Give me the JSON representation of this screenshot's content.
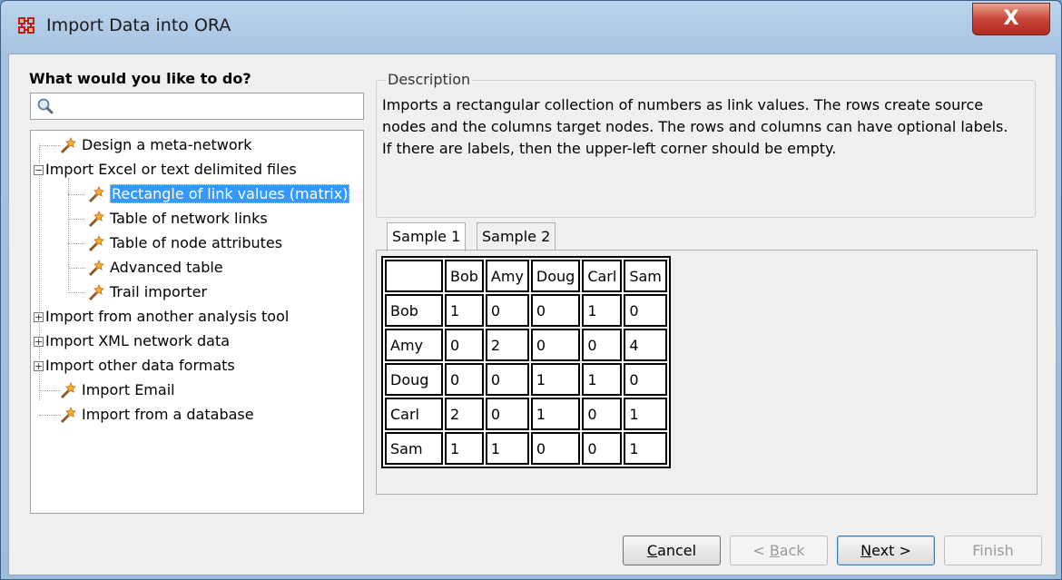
{
  "window": {
    "title": "Import Data into ORA",
    "close_glyph": "X",
    "app_icon": "ora-grid-icon"
  },
  "left": {
    "heading": "What would you like to do?",
    "search": {
      "placeholder": "",
      "icon": "search-icon"
    },
    "tree": [
      {
        "label": "Design a meta-network",
        "level": 0,
        "wand": true
      },
      {
        "label": "Import Excel or text delimited files",
        "level": 0,
        "expander": "−"
      },
      {
        "label": "Rectangle of link values (matrix)",
        "level": 1,
        "wand": true,
        "selected": true
      },
      {
        "label": "Table of network links",
        "level": 1,
        "wand": true
      },
      {
        "label": "Table of node attributes",
        "level": 1,
        "wand": true
      },
      {
        "label": "Advanced table",
        "level": 1,
        "wand": true
      },
      {
        "label": "Trail importer",
        "level": 1,
        "wand": true
      },
      {
        "label": "Import from another analysis tool",
        "level": 0,
        "expander": "+"
      },
      {
        "label": "Import XML network data",
        "level": 0,
        "expander": "+"
      },
      {
        "label": "Import other data formats",
        "level": 0,
        "expander": "+"
      },
      {
        "label": "Import Email",
        "level": 0,
        "wand": true
      },
      {
        "label": "Import from a database",
        "level": 0,
        "wand": true
      }
    ]
  },
  "description": {
    "label": "Description",
    "text": "Imports a rectangular collection of numbers as link values. The rows create source nodes and the columns target nodes. The rows and columns can have optional labels. If there are labels, then the upper-left corner should be empty."
  },
  "tabs": [
    {
      "label": "Sample 1",
      "active": true
    },
    {
      "label": "Sample 2",
      "active": false
    }
  ],
  "sample_table": {
    "header": [
      "",
      "Bob",
      "Amy",
      "Doug",
      "Carl",
      "Sam"
    ],
    "rows": [
      [
        "Bob",
        "1",
        "0",
        "0",
        "1",
        "0"
      ],
      [
        "Amy",
        "0",
        "2",
        "0",
        "0",
        "4"
      ],
      [
        "Doug",
        "0",
        "0",
        "1",
        "1",
        "0"
      ],
      [
        "Carl",
        "2",
        "0",
        "1",
        "0",
        "1"
      ],
      [
        "Sam",
        "1",
        "1",
        "0",
        "0",
        "1"
      ]
    ]
  },
  "buttons": {
    "cancel": {
      "pre": "",
      "u": "C",
      "post": "ancel",
      "enabled": true
    },
    "back": {
      "pre": "< ",
      "u": "B",
      "post": "ack",
      "enabled": false
    },
    "next": {
      "pre": "",
      "u": "N",
      "post": "ext >",
      "enabled": true
    },
    "finish": {
      "pre": "",
      "u": "",
      "post": "Finish",
      "enabled": false
    }
  },
  "colors": {
    "selection": "#3399ff",
    "title_bar": "#a6c3e2",
    "close_button": "#c9463a"
  }
}
